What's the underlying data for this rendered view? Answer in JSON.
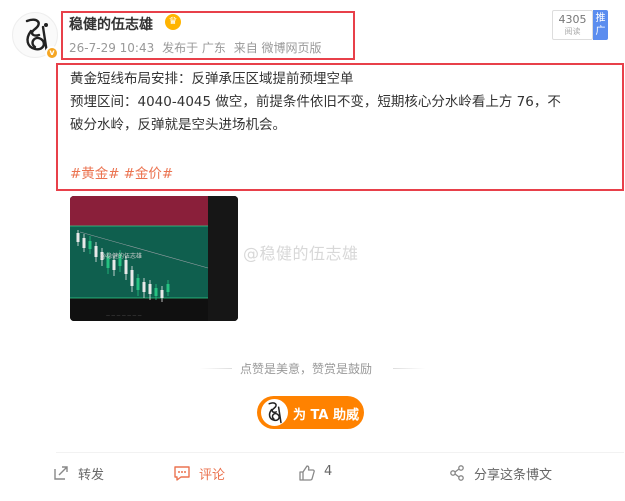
{
  "user": {
    "name": "稳健的伍志雄",
    "icons": {
      "avatar": "calligraphy-logo",
      "verified": "v-badge",
      "member": "crown-icon"
    }
  },
  "meta": {
    "time": "26-7-29 10:43",
    "location": "发布于 广东",
    "source": "来自 微博网页版"
  },
  "stats": {
    "read_count": "4305",
    "read_label": "阅读",
    "ad_label": "推广"
  },
  "post": {
    "line1": "黄金短线布局安排：反弹承压区域提前预埋空单",
    "line2": "预埋区间：4040-4045 做空，前提条件依旧不变，短期核心分水岭看上方 76，不",
    "line3": "破分水岭，反弹就是空头进场机会。",
    "tags": [
      "#黄金#",
      "#金价#"
    ]
  },
  "image": {
    "watermark_small": "@稳健的伍志雄",
    "colors": {
      "top_zone": "#8a1f3a",
      "mid_zone": "#0f5f4e",
      "bg": "#101010"
    }
  },
  "watermark": "@稳健的伍志雄",
  "reward": {
    "note": "点赞是美意，赞赏是鼓励",
    "button_label": "为 TA 助威"
  },
  "actions": {
    "forward": "转发",
    "comment": "评论",
    "like_count": "4",
    "share": "分享这条博文"
  },
  "colors": {
    "highlight_border": "#e8404a",
    "accent": "#eb7350",
    "reward": "#ff8200"
  }
}
